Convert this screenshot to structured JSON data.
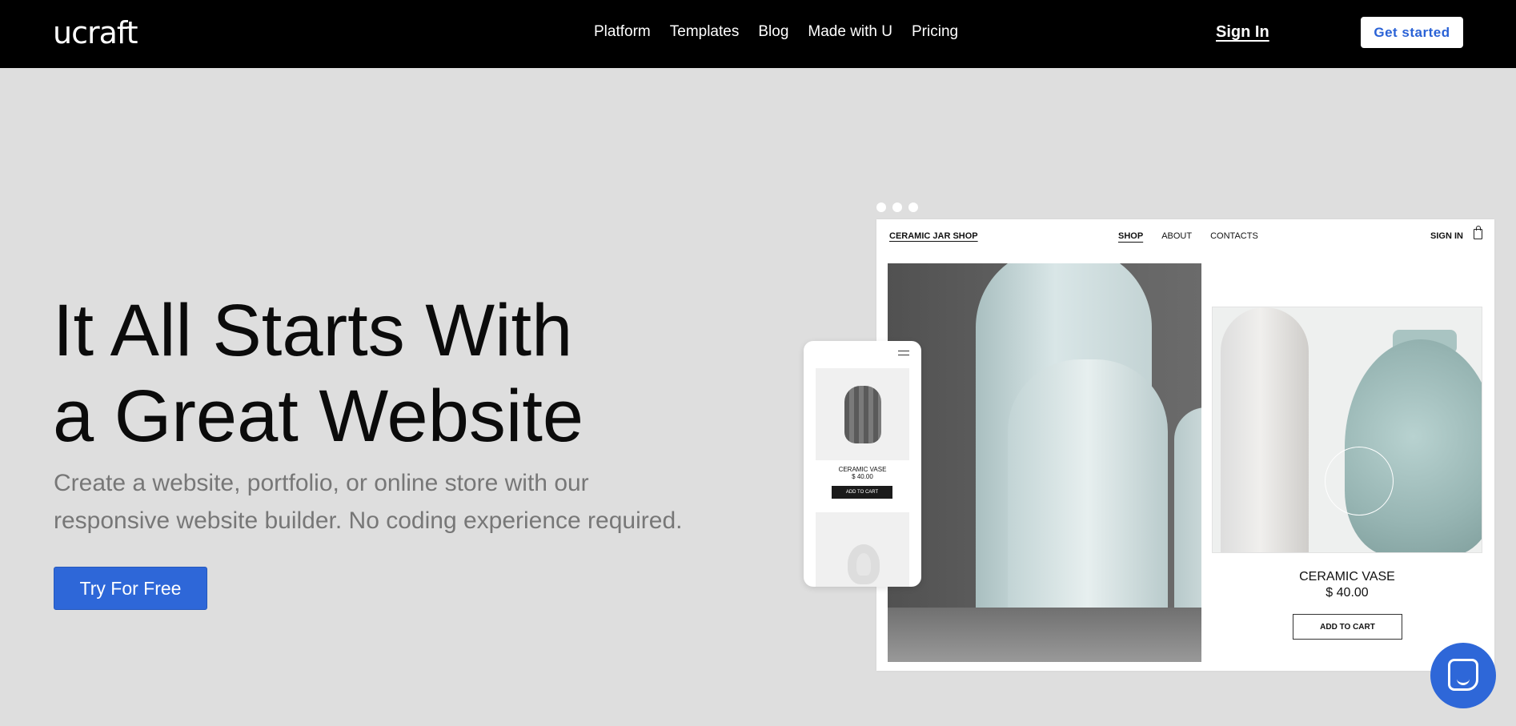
{
  "header": {
    "logo": "ucraft",
    "nav": [
      "Platform",
      "Templates",
      "Blog",
      "Made with U",
      "Pricing"
    ],
    "sign_in": "Sign In",
    "get_started": "Get started"
  },
  "hero": {
    "headline_line1": "It All Starts With",
    "headline_line2": "a Great Website",
    "subtitle": "Create a website, portfolio, or online store with our responsive website builder. No coding experience required.",
    "cta": "Try For Free"
  },
  "mockup": {
    "shop_name": "CERAMIC JAR SHOP",
    "nav": [
      "SHOP",
      "ABOUT",
      "CONTACTS"
    ],
    "sign_in": "SIGN IN",
    "product_name": "CERAMIC VASE",
    "product_price": "$ 40.00",
    "add_to_cart": "ADD TO CART",
    "phone_product_name": "CERAMIC VASE",
    "phone_product_price": "$ 40.00",
    "phone_add_to_cart": "ADD TO CART"
  },
  "colors": {
    "header_bg": "#000000",
    "page_bg": "#dedede",
    "accent": "#2e67d8"
  },
  "icons": [
    "shopping-bag-icon",
    "hamburger-menu-icon",
    "chat-icon"
  ]
}
